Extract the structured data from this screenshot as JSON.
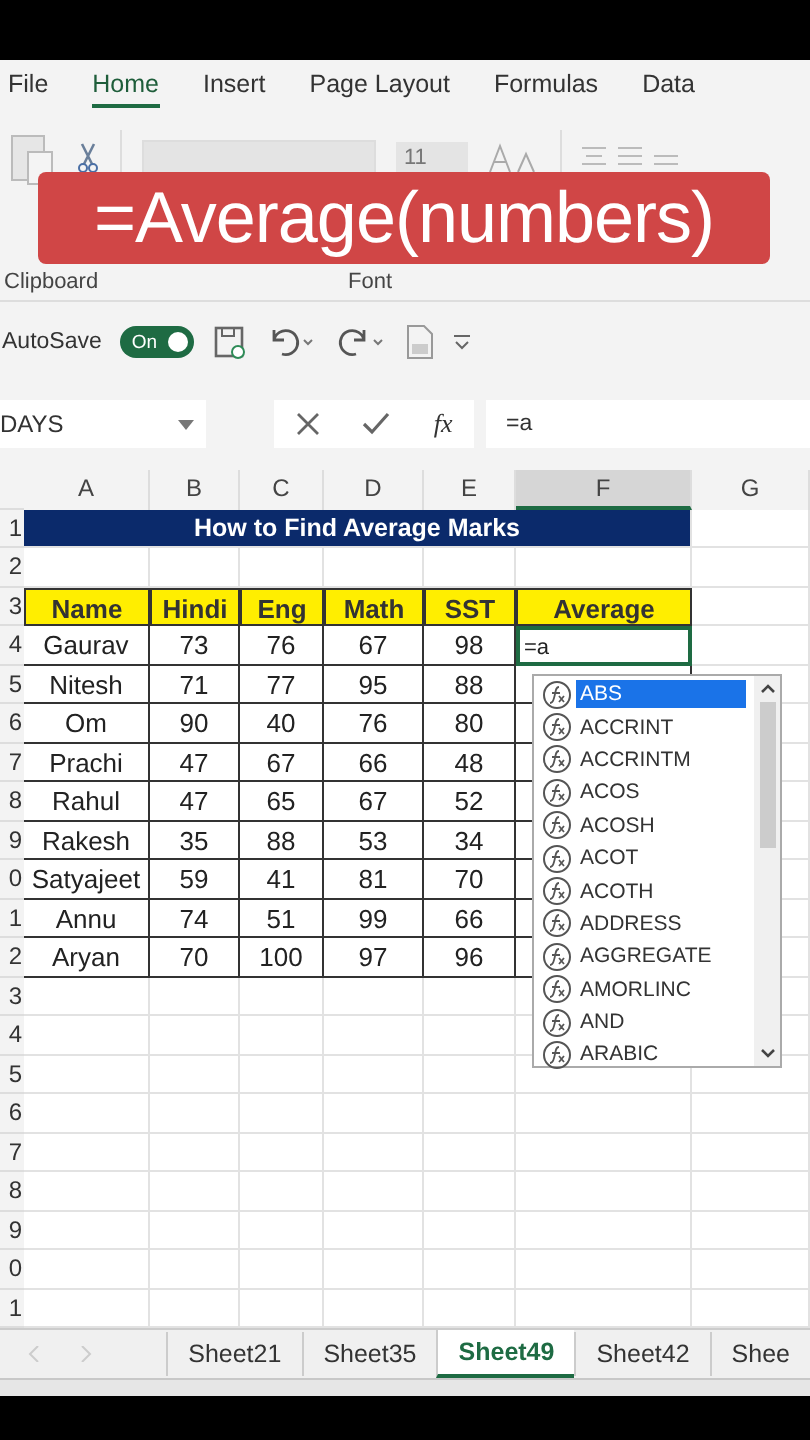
{
  "ribbon_tabs": [
    {
      "label": "File",
      "selected": false
    },
    {
      "label": "Home",
      "selected": true
    },
    {
      "label": "Insert",
      "selected": false
    },
    {
      "label": "Page Layout",
      "selected": false
    },
    {
      "label": "Formulas",
      "selected": false
    },
    {
      "label": "Data",
      "selected": false
    }
  ],
  "ribbon": {
    "font_size": "11",
    "groups": [
      "Clipboard",
      "Font"
    ]
  },
  "banner": "=Average(numbers)",
  "quick_access": {
    "autosave_label": "AutoSave",
    "autosave": {
      "label": "On",
      "on": true
    }
  },
  "formula_bar": {
    "name_box": "DAYS",
    "insert_function": "fx",
    "formula": "=a"
  },
  "sheet": {
    "columns": [
      {
        "label": "A",
        "selected": false
      },
      {
        "label": "B",
        "selected": false
      },
      {
        "label": "C",
        "selected": false
      },
      {
        "label": "D",
        "selected": false
      },
      {
        "label": "E",
        "selected": false
      },
      {
        "label": "F",
        "selected": true
      },
      {
        "label": "G",
        "selected": false
      }
    ],
    "row_numbers": [
      "1",
      "2",
      "3",
      "4",
      "5",
      "6",
      "7",
      "8",
      "9",
      "0",
      "1",
      "2",
      "3",
      "4",
      "5",
      "6",
      "7",
      "8",
      "9",
      "0",
      "1"
    ],
    "title": "How to Find Average Marks",
    "header": [
      "Name",
      "Hindi",
      "Eng",
      "Math",
      "SST",
      "Average"
    ],
    "rows": [
      {
        "name": "Gaurav",
        "marks": [
          "73",
          "76",
          "67",
          "98"
        ]
      },
      {
        "name": "Nitesh",
        "marks": [
          "71",
          "77",
          "95",
          "88"
        ]
      },
      {
        "name": "Om",
        "marks": [
          "90",
          "40",
          "76",
          "80"
        ]
      },
      {
        "name": "Prachi",
        "marks": [
          "47",
          "67",
          "66",
          "48"
        ]
      },
      {
        "name": "Rahul",
        "marks": [
          "47",
          "65",
          "67",
          "52"
        ]
      },
      {
        "name": "Rakesh",
        "marks": [
          "35",
          "88",
          "53",
          "34"
        ]
      },
      {
        "name": "Satyajeet",
        "marks": [
          "59",
          "41",
          "81",
          "70"
        ]
      },
      {
        "name": "Annu",
        "marks": [
          "74",
          "51",
          "99",
          "66"
        ]
      },
      {
        "name": "Aryan",
        "marks": [
          "70",
          "100",
          "97",
          "96"
        ]
      }
    ],
    "active_cell": {
      "value": "=a"
    },
    "autocomplete": [
      {
        "label": "ABS",
        "selected": true
      },
      {
        "label": "ACCRINT",
        "selected": false
      },
      {
        "label": "ACCRINTM",
        "selected": false
      },
      {
        "label": "ACOS",
        "selected": false
      },
      {
        "label": "ACOSH",
        "selected": false
      },
      {
        "label": "ACOT",
        "selected": false
      },
      {
        "label": "ACOTH",
        "selected": false
      },
      {
        "label": "ADDRESS",
        "selected": false
      },
      {
        "label": "AGGREGATE",
        "selected": false
      },
      {
        "label": "AMORLINC",
        "selected": false
      },
      {
        "label": "AND",
        "selected": false
      },
      {
        "label": "ARABIC",
        "selected": false
      }
    ]
  },
  "sheet_tabs": [
    {
      "label": "Sheet21",
      "selected": false
    },
    {
      "label": "Sheet35",
      "selected": false
    },
    {
      "label": "Sheet49",
      "selected": true
    },
    {
      "label": "Sheet42",
      "selected": false
    },
    {
      "label": "Shee",
      "selected": false
    }
  ]
}
